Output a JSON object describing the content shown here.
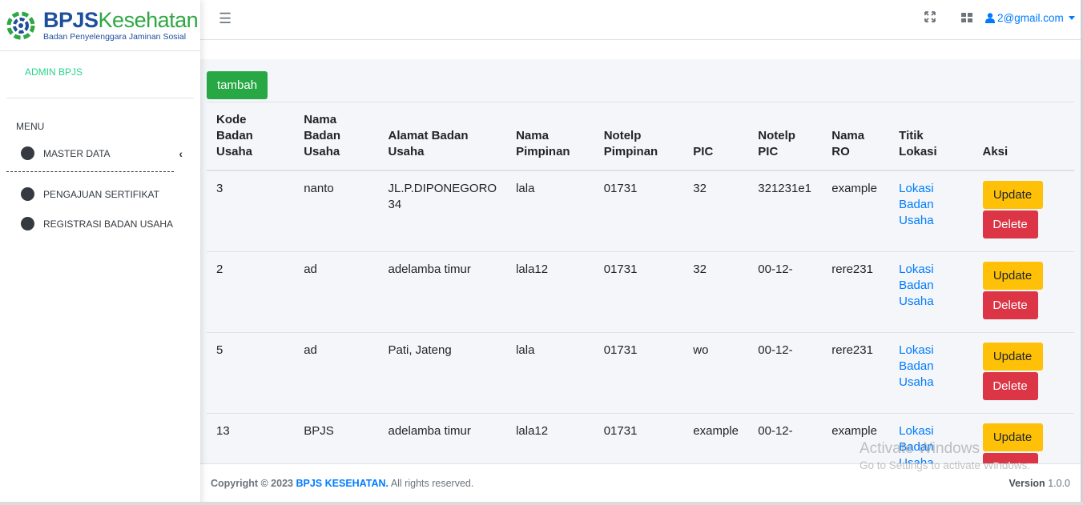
{
  "brand": {
    "name_part1": "BPJS",
    "name_part2": "Kesehatan",
    "subtitle": "Badan Penyelenggara Jaminan Sosial"
  },
  "user_panel": {
    "label": "ADMIN BPJS"
  },
  "sidebar": {
    "menu_header": "MENU",
    "items": [
      {
        "label": "MASTER DATA"
      },
      {
        "label": "PENGAJUAN SERTIFIKAT"
      },
      {
        "label": "REGISTRASI BADAN USAHA"
      }
    ]
  },
  "navbar": {
    "user_email": "2@gmail.com"
  },
  "main": {
    "add_button_label": "tambah"
  },
  "table": {
    "headers": {
      "kode": "Kode Badan Usaha",
      "nama": "Nama Badan Usaha",
      "alamat": "Alamat Badan Usaha",
      "pimpinan": "Nama Pimpinan",
      "notelp_pimpinan": "Notelp Pimpinan",
      "pic": "PIC",
      "notelp_pic": "Notelp PIC",
      "ro": "Nama RO",
      "titik": "Titik Lokasi",
      "aksi": "Aksi"
    },
    "rows": [
      {
        "kode": "3",
        "nama": "nanto",
        "alamat": "JL.P.DIPONEGORO 34",
        "pimpinan": "lala",
        "notelp_pimpinan": "01731",
        "pic": "32",
        "notelp_pic": "321231e1",
        "ro": "example",
        "lokasi": "Lokasi Badan Usaha",
        "update": "Update",
        "delete": "Delete"
      },
      {
        "kode": "2",
        "nama": "ad",
        "alamat": "adelamba timur",
        "pimpinan": "lala12",
        "notelp_pimpinan": "01731",
        "pic": "32",
        "notelp_pic": "00-12-",
        "ro": "rere231",
        "lokasi": "Lokasi Badan Usaha",
        "update": "Update",
        "delete": "Delete"
      },
      {
        "kode": "5",
        "nama": "ad",
        "alamat": "Pati, Jateng",
        "pimpinan": "lala",
        "notelp_pimpinan": "01731",
        "pic": "wo",
        "notelp_pic": "00-12-",
        "ro": "rere231",
        "lokasi": "Lokasi Badan Usaha",
        "update": "Update",
        "delete": "Delete"
      },
      {
        "kode": "13",
        "nama": "BPJS",
        "alamat": "adelamba timur",
        "pimpinan": "lala12",
        "notelp_pimpinan": "01731",
        "pic": "example",
        "notelp_pic": "00-12-",
        "ro": "example",
        "lokasi": "Lokasi Badan Usaha",
        "update": "Update",
        "delete": "Delete"
      }
    ]
  },
  "footer": {
    "copyright_prefix": "Copyright © 2023",
    "brand_link": "BPJS KESEHATAN.",
    "rights": "All rights reserved.",
    "version_label": "Version",
    "version_value": "1.0.0"
  },
  "watermark": {
    "line1": "Activate Windows",
    "line2": "Go to Settings to activate Windows."
  },
  "colors": {
    "primary": "#007bff",
    "success": "#28a745",
    "warning": "#ffc107",
    "danger": "#dc3545",
    "brand_blue": "#1e4f9c",
    "brand_green": "#2fa843"
  }
}
